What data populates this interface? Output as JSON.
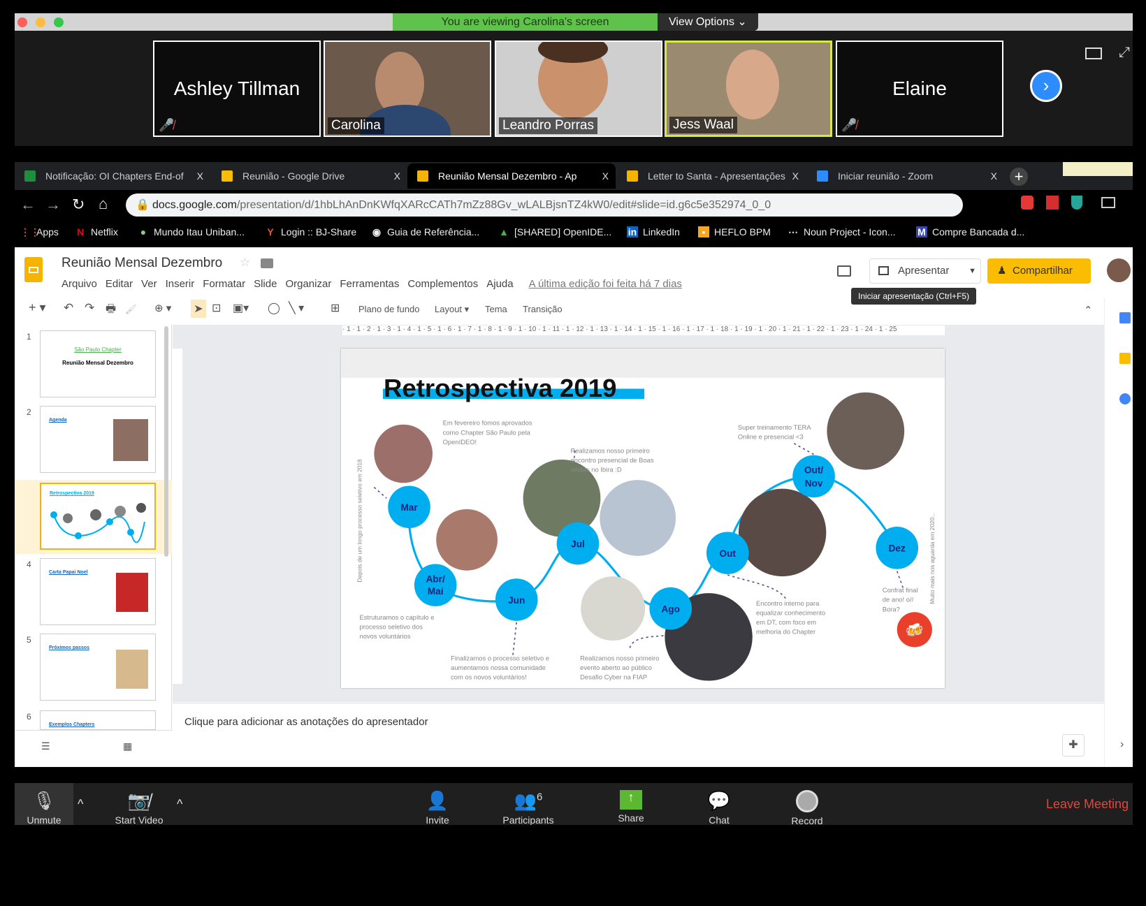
{
  "zoom": {
    "banner": "You are viewing Carolina's screen",
    "view_options": "View Options ⌄",
    "participants": [
      {
        "name": "Ashley Tillman",
        "video": false,
        "muted": true
      },
      {
        "name": "Carolina",
        "video": true
      },
      {
        "name": "Leandro Porras",
        "video": true
      },
      {
        "name": "Jess Waal",
        "video": true,
        "active_speaker": true
      },
      {
        "name": "Elaine",
        "video": false,
        "muted": true
      }
    ],
    "toolbar": {
      "unmute": "Unmute",
      "start_video": "Start Video",
      "invite": "Invite",
      "participants": "Participants",
      "participant_count": "6",
      "share": "Share",
      "chat": "Chat",
      "record": "Record",
      "leave": "Leave Meeting"
    }
  },
  "browser": {
    "tabs": [
      {
        "label": "Notificação: OI Chapters End-of",
        "close": "X"
      },
      {
        "label": "Reunião - Google Drive",
        "close": "X"
      },
      {
        "label": "Reunião Mensal Dezembro - Ap",
        "close": "X",
        "active": true
      },
      {
        "label": "Letter to Santa - Apresentações",
        "close": "X"
      },
      {
        "label": "Iniciar reunião - Zoom",
        "close": "X"
      }
    ],
    "url_host": "docs.google.com",
    "url_path": "/presentation/d/1hbLhAnDnKWfqXARcCATh7mZz88Gv_wLALBjsnTZ4kW0/edit#slide=id.g6c5e352974_0_0",
    "bookmarks": [
      "Apps",
      "Netflix",
      "Mundo Itau Uniban...",
      "Login :: BJ-Share",
      "Guia de Referência...",
      "[SHARED] OpenIDE...",
      "LinkedIn",
      "HEFLO BPM",
      "Noun Project - Icon...",
      "Compre Bancada d..."
    ]
  },
  "slides": {
    "title": "Reunião Mensal Dezembro",
    "menu": [
      "Arquivo",
      "Editar",
      "Ver",
      "Inserir",
      "Formatar",
      "Slide",
      "Organizar",
      "Ferramentas",
      "Complementos",
      "Ajuda"
    ],
    "last_edit": "A última edição foi feita há 7 dias",
    "present": "Apresentar",
    "share": "Compartilhar",
    "tooltip": "Iniciar apresentação (Ctrl+F5)",
    "toolbar": {
      "background": "Plano de fundo",
      "layout": "Layout ▾",
      "theme": "Tema",
      "transition": "Transição"
    },
    "ruler": "· 1 · 1 · 2 · 1 · 3 · 1 · 4 · 1 · 5 · 1 · 6 · 1 · 7 · 1 · 8 · 1 · 9 · 1 · 10 · 1 · 11 · 1 · 12 · 1 · 13 · 1 · 14 · 1 · 15 · 1 · 16 · 1 · 17 · 1 · 18 · 1 · 19 · 1 · 20 · 1 · 21 · 1 · 22 · 1 · 23 · 1 · 24 · 1 · 25",
    "thumbnails": [
      {
        "num": "1",
        "title": "Reunião Mensal Dezembro",
        "sub": "São Paulo Chapter"
      },
      {
        "num": "2",
        "title": "Agenda"
      },
      {
        "num": "3",
        "title": "Retrospectiva 2019",
        "selected": true
      },
      {
        "num": "4",
        "title": "Carta Papai Noel"
      },
      {
        "num": "5",
        "title": "Próximos passos"
      },
      {
        "num": "6",
        "title": "Exemplos Chapters"
      }
    ],
    "notes_placeholder": "Clique para adicionar as anotações do apresentador",
    "accent": "#fbbc04"
  },
  "slide": {
    "title": "Retrospectiva 2019",
    "accent": "#00aeef",
    "months": [
      "Mar",
      "Abr/",
      "Mai",
      "Jun",
      "Jul",
      "Ago",
      "Out",
      "Out/",
      "Nov",
      "Dez"
    ],
    "captions": {
      "feb": [
        "Em fevereiro fomos aprovados",
        "como Chapter São Paulo pela",
        "OpenIDEO!"
      ],
      "jul": [
        "Realizamos nosso primeiro",
        "encontro presencial de Boas",
        "vindas no Ibira :D"
      ],
      "tera": [
        "Super treinamento TERA",
        "Online e presencial <3"
      ],
      "abr": [
        "Estruturamos o capítulo e",
        "processo seletivo dos",
        "novos voluntários"
      ],
      "jun": [
        "Finalizamos o processo seletivo e",
        "aumentamos nossa comunidade",
        "com os novos voluntários!"
      ],
      "ago": [
        "Realizamos nosso primeiro",
        "evento aberto ao público",
        "Desafio Cyber na FIAP"
      ],
      "out": [
        "Encontro interno para",
        "equalizar conhecimento",
        "em DT, com foco em",
        "melhoria do Chapter"
      ],
      "dez": [
        "Confrat final",
        "de ano! o//",
        "Bora?"
      ]
    },
    "left_vertical": "Depois de um longo processo seletivo em 2018",
    "right_vertical": "Muito mais nos aguarda em 2020..."
  }
}
